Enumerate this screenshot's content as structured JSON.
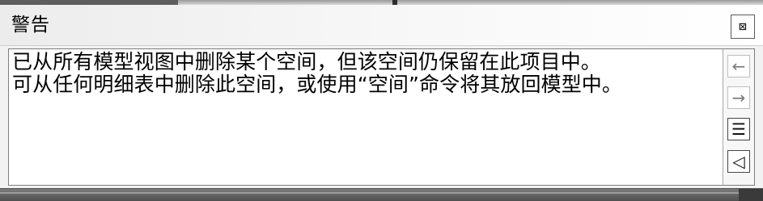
{
  "dialog": {
    "title": "警告",
    "close_label": "⊠"
  },
  "message": {
    "lines": [
      "已从所有模型视图中删除某个空间，但该空间仍保留在此项目中。",
      "可从任何明细表中删除此空间，或使用“空间”命令将其放回模型中。"
    ]
  },
  "controls": {
    "prev_label": "←",
    "next_label": "→",
    "details_label": "☰",
    "sound_label": "◁"
  },
  "icons": {
    "close": "close-icon",
    "previous": "arrow-left-icon",
    "next": "arrow-right-icon",
    "details": "list-icon",
    "sound": "speaker-icon"
  },
  "colors": {
    "panel_border": "#7d7d7d",
    "window_background": "#f2f2f2",
    "message_background": "#ffffff"
  }
}
